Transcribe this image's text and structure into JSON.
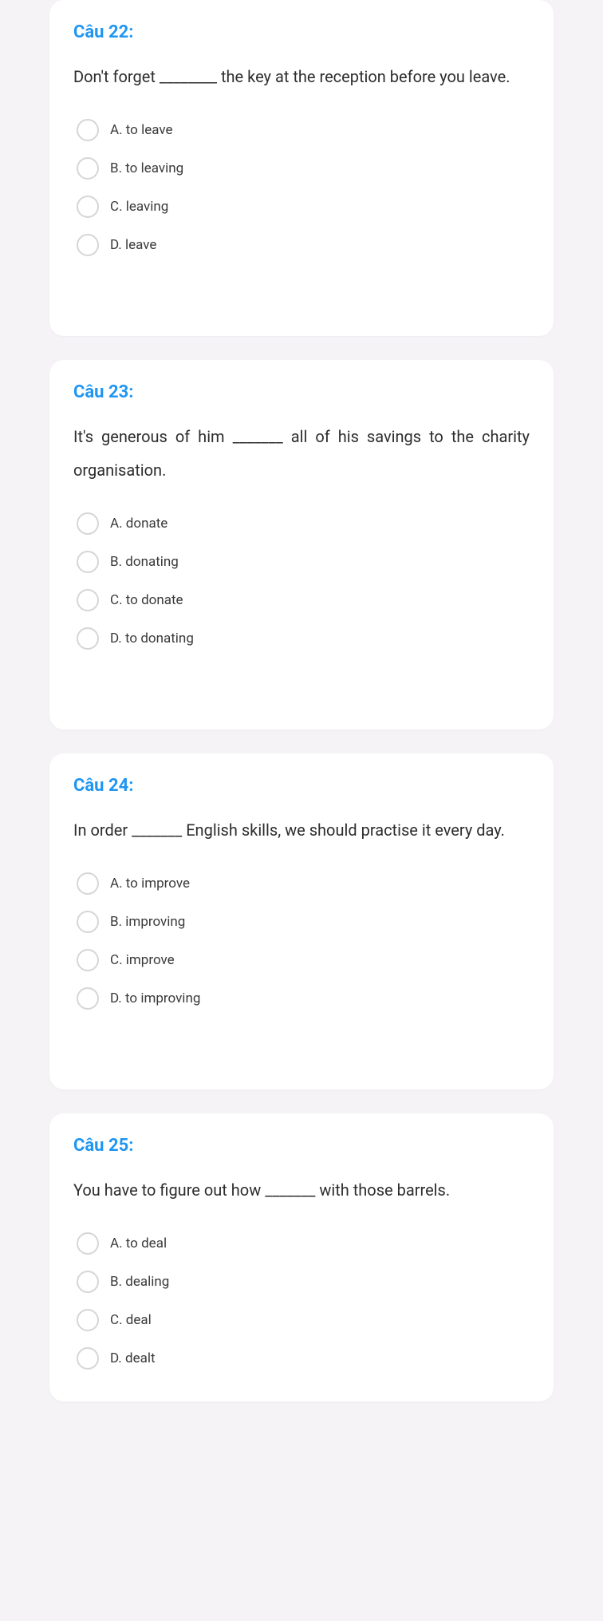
{
  "questions": [
    {
      "title": "Câu 22:",
      "text": "Don't forget ________ the key at the reception before you leave.",
      "options": [
        {
          "label": "A. to leave"
        },
        {
          "label": "B. to leaving"
        },
        {
          "label": "C. leaving"
        },
        {
          "label": "D. leave"
        }
      ]
    },
    {
      "title": "Câu 23:",
      "text": "It's generous of him _______ all of his savings to the charity organisation.",
      "options": [
        {
          "label": "A. donate"
        },
        {
          "label": "B. donating"
        },
        {
          "label": "C. to donate"
        },
        {
          "label": "D. to donating"
        }
      ]
    },
    {
      "title": "Câu 24:",
      "text": "In order _______ English skills, we should practise it every day.",
      "options": [
        {
          "label": "A. to improve"
        },
        {
          "label": "B. improving"
        },
        {
          "label": "C. improve"
        },
        {
          "label": "D. to improving"
        }
      ]
    },
    {
      "title": "Câu 25:",
      "text": "You have to figure out how _______ with those barrels.",
      "options": [
        {
          "label": "A. to deal"
        },
        {
          "label": "B. dealing"
        },
        {
          "label": "C. deal"
        },
        {
          "label": "D. dealt"
        }
      ]
    }
  ]
}
